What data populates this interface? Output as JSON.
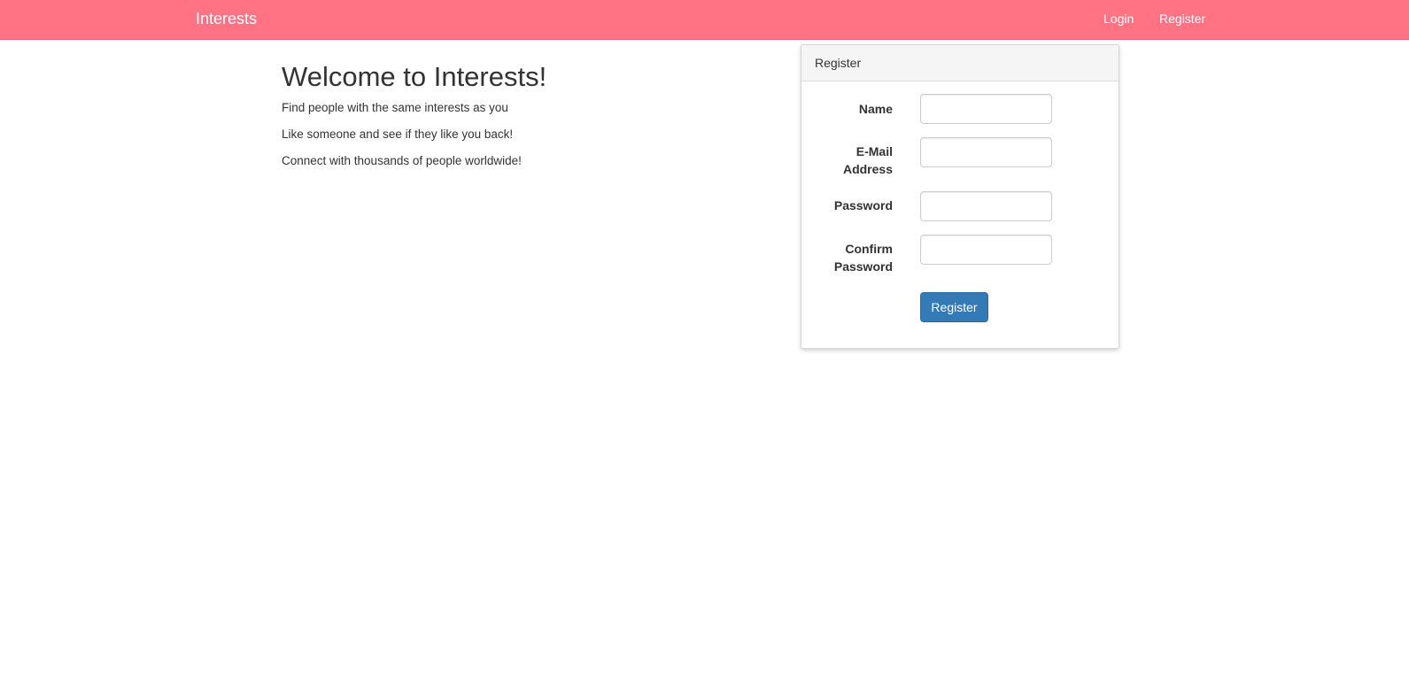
{
  "navbar": {
    "brand": "Interests",
    "links": [
      {
        "label": "Login"
      },
      {
        "label": "Register"
      }
    ],
    "background_color": "#ff7385"
  },
  "welcome": {
    "title": "Welcome to Interests!",
    "lines": [
      "Find people with the same interests as you",
      "Like someone and see if they like you back!",
      "Connect with thousands of people worldwide!"
    ]
  },
  "register_panel": {
    "heading": "Register",
    "fields": {
      "name": {
        "label": "Name",
        "value": "",
        "placeholder": ""
      },
      "email": {
        "label_line1": "E-Mail",
        "label_line2": "Address",
        "value": "",
        "placeholder": ""
      },
      "password": {
        "label": "Password",
        "value": "",
        "placeholder": ""
      },
      "confirm_password": {
        "label_line1": "Confirm",
        "label_line2": "Password",
        "value": "",
        "placeholder": ""
      }
    },
    "submit_label": "Register",
    "submit_color": "#337ab7"
  }
}
